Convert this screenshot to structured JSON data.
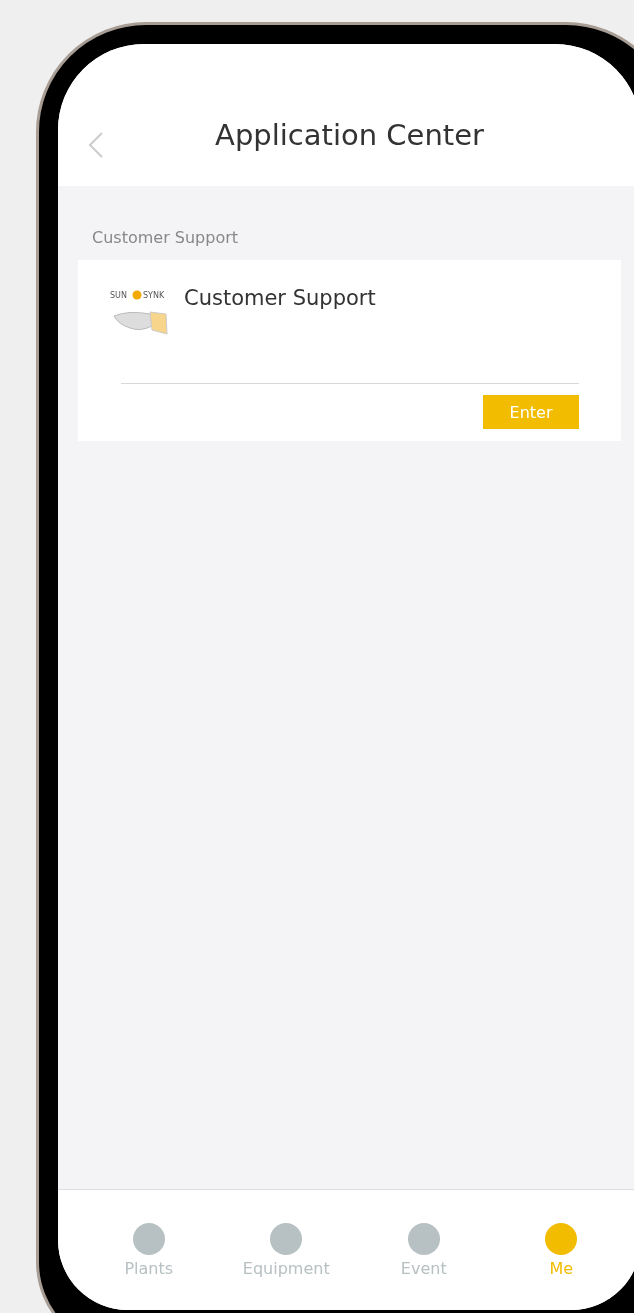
{
  "header": {
    "title": "Application Center"
  },
  "section": {
    "label": "Customer Support"
  },
  "apps": [
    {
      "logo_left": "SUN",
      "logo_right": "SYNK",
      "title": "Customer Support",
      "button": "Enter"
    }
  ],
  "tabs": [
    {
      "label": "Plants",
      "selected": false
    },
    {
      "label": "Equipment",
      "selected": false
    },
    {
      "label": "Event",
      "selected": false
    },
    {
      "label": "Me",
      "selected": true
    }
  ]
}
